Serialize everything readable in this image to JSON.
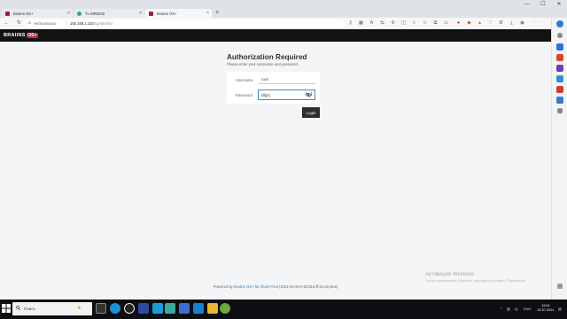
{
  "browser": {
    "tabs": [
      {
        "title": "Braiins OS+",
        "active": false
      },
      {
        "title": "TL-MR6400",
        "active": false
      },
      {
        "title": "Braiins OS+",
        "active": true
      }
    ],
    "address": {
      "security_label": "Небезопасно",
      "host": "192.168.1.102",
      "path": "/cgi-bin/luci"
    }
  },
  "app": {
    "logo_text": "BRAIINS",
    "logo_badge": "OS+",
    "brand_color": "#b7273d"
  },
  "login": {
    "title": "Authorization Required",
    "subtitle": "Please enter your username and password.",
    "username_label": "Username",
    "username_value": "root",
    "password_label": "Password",
    "password_value": "dfghj",
    "login_button": "Login"
  },
  "footer": {
    "prefix": "Powered by",
    "product": "Braiins OS+",
    "middle": "for",
    "pool": "Slush Pool",
    "version": "(2021-04-29-0-52331cff-21.04-plus)"
  },
  "watermark": {
    "title": "Активация Windows",
    "subtitle": "Чтобы активировать Windows, перейдите в раздел \"Параметры\"."
  },
  "taskbar": {
    "search_placeholder": "Поиск",
    "language": "ENG",
    "time": "19:01",
    "date": "22.07.2021"
  }
}
